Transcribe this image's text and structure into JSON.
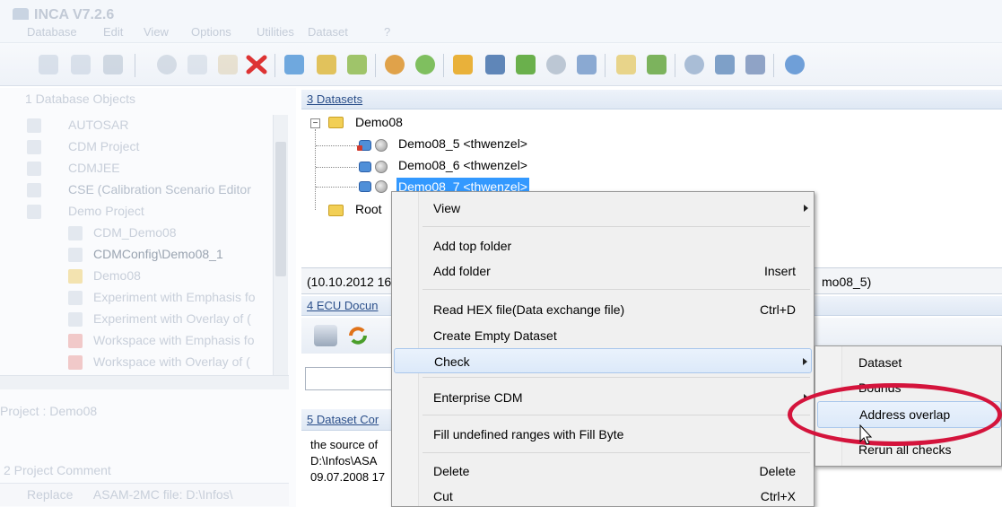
{
  "app": {
    "title": "INCA V7.2.6"
  },
  "menubar": {
    "items": [
      "Database",
      "Edit",
      "View",
      "Options",
      "Utilities",
      "Dataset",
      "?"
    ]
  },
  "toolbar": {
    "icons": [
      "new-icon",
      "save-icon",
      "link-icon",
      "copy-icon",
      "paste-icon",
      "delete-icon",
      "props-icon",
      "tree-icon",
      "tree-add-icon",
      "import-icon",
      "export-icon",
      "folder-icon",
      "ecu-icon",
      "package-icon",
      "search-icon",
      "compare-icon",
      "check-icon",
      "monitor-icon",
      "zoom-icon",
      "grid-icon",
      "edit-icon",
      "help-icon"
    ]
  },
  "left_panel": {
    "header": "1 Database Objects",
    "items": [
      {
        "label": "AUTOSAR",
        "level": 1
      },
      {
        "label": "CDM Project",
        "level": 1
      },
      {
        "label": "CDMJEE",
        "level": 1
      },
      {
        "label": "CSE (Calibration Scenario Editor",
        "level": 1
      },
      {
        "label": "Demo Project",
        "level": 1
      },
      {
        "label": "CDM_Demo08",
        "level": 2
      },
      {
        "label": "CDMConfig\\Demo08_1",
        "level": 2
      },
      {
        "label": "Demo08",
        "level": 2
      },
      {
        "label": "Experiment with Emphasis fo",
        "level": 2
      },
      {
        "label": "Experiment with Overlay of (",
        "level": 2
      },
      {
        "label": "Workspace with Emphasis fo",
        "level": 2
      },
      {
        "label": "Workspace with Overlay of (",
        "level": 2
      }
    ],
    "project_label": "Project : Demo08",
    "comment_header": "2 Project Comment",
    "comment_text": "Replace      ASAM-2MC file: D:\\Infos\\"
  },
  "datasets_panel": {
    "header": "3 Datasets",
    "root_folder": "Demo08",
    "datasets": [
      "Demo08_5 <thwenzel>",
      "Demo08_6 <thwenzel>",
      "Demo08_7 <thwenzel>"
    ],
    "selected_index": 2,
    "second_folder": "Root",
    "info_left": "(10.10.2012 16",
    "info_right": "mo08_5)"
  },
  "ecu_panel": {
    "header": "4 ECU Docun"
  },
  "comments_panel": {
    "header": "5 Dataset Cor",
    "lines": [
      "the source of",
      "D:\\Infos\\ASA",
      "09.07.2008 17"
    ]
  },
  "context_menu": {
    "items": [
      {
        "label": "View",
        "shortcut": "",
        "submenu": true
      },
      {
        "label": "Add top folder",
        "shortcut": "",
        "submenu": false
      },
      {
        "label": "Add folder",
        "shortcut": "Insert",
        "submenu": false
      },
      {
        "label": "Read HEX file(Data exchange file)",
        "shortcut": "Ctrl+D",
        "submenu": false
      },
      {
        "label": "Create Empty Dataset",
        "shortcut": "",
        "submenu": false
      },
      {
        "label": "Check",
        "shortcut": "",
        "submenu": true
      },
      {
        "label": "Enterprise CDM",
        "shortcut": "",
        "submenu": true
      },
      {
        "label": "Fill undefined ranges with Fill Byte",
        "shortcut": "",
        "submenu": false
      },
      {
        "label": "Delete",
        "shortcut": "Delete",
        "submenu": false
      },
      {
        "label": "Cut",
        "shortcut": "Ctrl+X",
        "submenu": false
      }
    ],
    "highlighted": "Check"
  },
  "check_submenu": {
    "items": [
      "Dataset",
      "Bounds",
      "Address overlap",
      "Rerun all checks"
    ],
    "highlighted": "Address overlap"
  },
  "colors": {
    "selection": "#3399ff",
    "highlight_ring": "#d4143c",
    "menu_bg": "#f0f0f0",
    "panel_header": "#2b4f8a"
  }
}
